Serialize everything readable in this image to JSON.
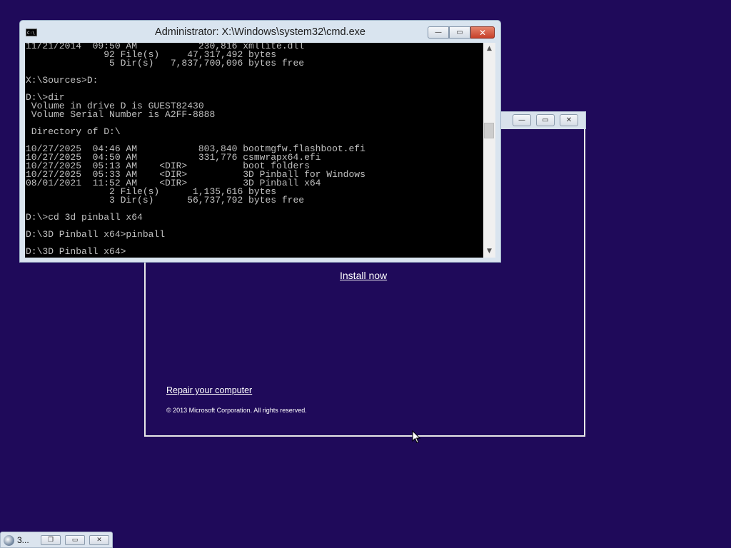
{
  "cmd": {
    "title": "Administrator: X:\\Windows\\system32\\cmd.exe",
    "icon_label": "C:\\",
    "buttons": {
      "minimize": "—",
      "maximize": "▭",
      "close": "✕"
    },
    "lines": [
      "11/21/2014  09:50 AM           230,816 xmllite.dll",
      "              92 File(s)     47,317,492 bytes",
      "               5 Dir(s)   7,837,700,096 bytes free",
      "",
      "X:\\Sources>D:",
      "",
      "D:\\>dir",
      " Volume in drive D is GUEST82430",
      " Volume Serial Number is A2FF-8888",
      "",
      " Directory of D:\\",
      "",
      "10/27/2025  04:46 AM           803,840 bootmgfw.flashboot.efi",
      "10/27/2025  04:50 AM           331,776 csmwrapx64.efi",
      "10/27/2025  05:13 AM    <DIR>          boot folders",
      "10/27/2025  05:33 AM    <DIR>          3D Pinball for Windows",
      "08/01/2021  11:52 AM    <DIR>          3D Pinball x64",
      "               2 File(s)      1,135,616 bytes",
      "               3 Dir(s)      56,737,792 bytes free",
      "",
      "D:\\>cd 3d pinball x64",
      "",
      "D:\\3D Pinball x64>pinball",
      "",
      "D:\\3D Pinball x64>"
    ],
    "scroll_up": "▲",
    "scroll_down": "▼"
  },
  "setup": {
    "install_now": "Install now",
    "repair": "Repair your computer",
    "copyright": "© 2013 Microsoft Corporation. All rights reserved.",
    "buttons": {
      "minimize": "—",
      "maximize": "▭",
      "close": "✕"
    }
  },
  "taskbar": {
    "label": "3...",
    "buttons": {
      "restore": "❐",
      "maximize": "▭",
      "close": "✕"
    }
  },
  "colors": {
    "desktop": "#1f0a5a",
    "console_bg": "#000000",
    "console_fg": "#c0c0c0"
  }
}
